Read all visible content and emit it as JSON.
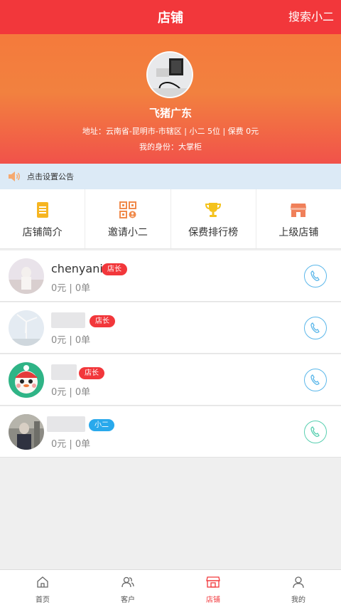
{
  "header": {
    "title": "店铺",
    "action_label": "搜索小二"
  },
  "store": {
    "name": "飞猪广东",
    "address": "地址：云南省-昆明市-市辖区 | 小二 5位 | 保费 0元",
    "identity": "我的身份：大掌柜"
  },
  "notice": {
    "text": "点击设置公告",
    "icon": "speaker-icon"
  },
  "menu": {
    "items": [
      {
        "label": "店铺简介",
        "icon": "document-icon",
        "color": "#f6b521"
      },
      {
        "label": "邀请小二",
        "icon": "qrcode-icon",
        "color": "#f08a4b"
      },
      {
        "label": "保费排行榜",
        "icon": "trophy-icon",
        "color": "#f4c21c"
      },
      {
        "label": "上级店铺",
        "icon": "storefront-icon",
        "color": "#f0805a"
      }
    ]
  },
  "members": [
    {
      "name": "chenyani",
      "role": "店长",
      "stats": "0元 | 0单"
    },
    {
      "name": "",
      "role": "店长",
      "stats": "0元 | 0单"
    },
    {
      "name": "",
      "role": "店长",
      "stats": "0元 | 0单"
    },
    {
      "name": "",
      "role": "小二",
      "stats": "0元 | 0单"
    }
  ],
  "tabbar": {
    "items": [
      {
        "label": "首页",
        "icon": "home-icon"
      },
      {
        "label": "客户",
        "icon": "customers-icon"
      },
      {
        "label": "店铺",
        "icon": "store-icon",
        "active": true
      },
      {
        "label": "我的",
        "icon": "profile-icon"
      }
    ]
  },
  "colors": {
    "primary": "#f2373b",
    "owner_badge": "#f2373b",
    "clerk_badge": "#29a9ec"
  }
}
